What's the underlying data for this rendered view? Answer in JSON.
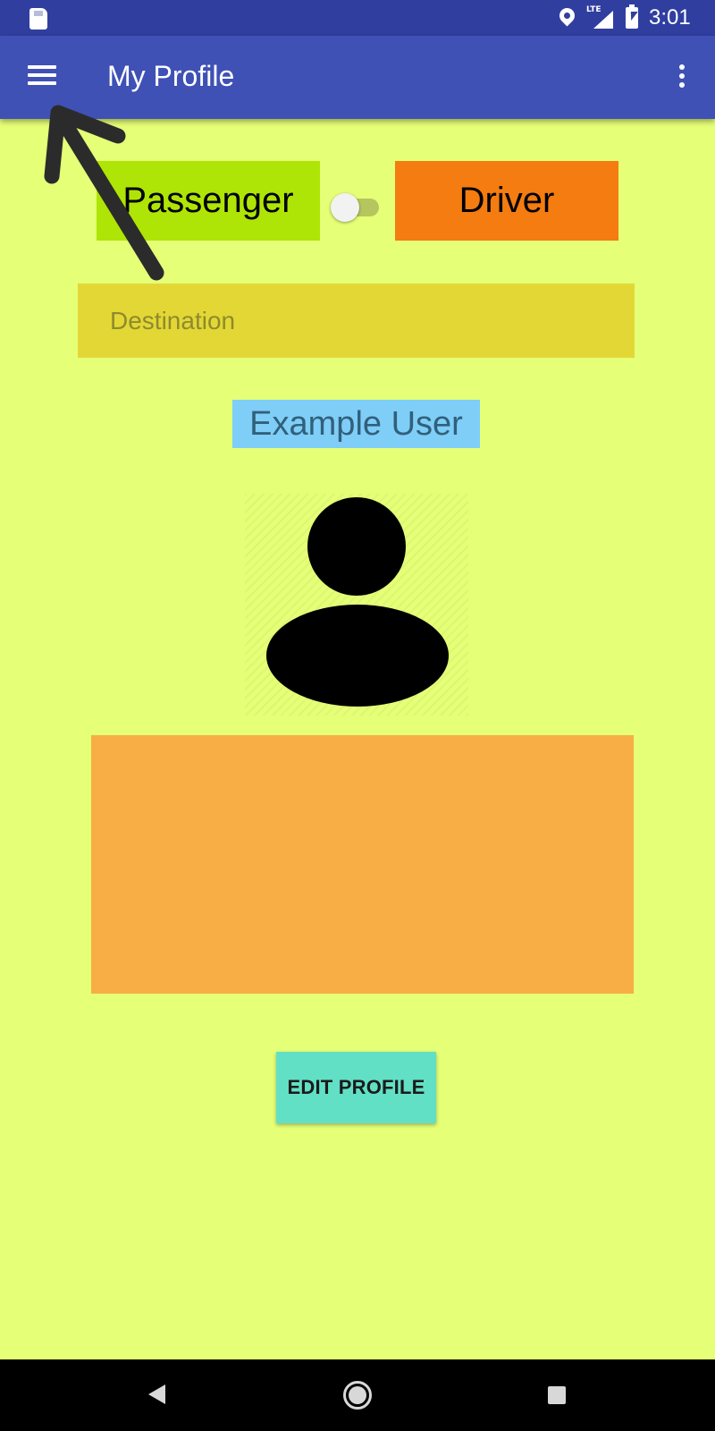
{
  "status_bar": {
    "time": "3:01",
    "network_label": "LTE",
    "icons": [
      "sd-card-icon",
      "location-icon",
      "signal-icon",
      "battery-charging-icon"
    ]
  },
  "app_bar": {
    "title": "My Profile",
    "menu_icon": "hamburger-menu-icon",
    "overflow_icon": "more-vert-icon"
  },
  "role_toggle": {
    "passenger_label": "Passenger",
    "driver_label": "Driver",
    "switch_on": false
  },
  "destination": {
    "placeholder": "Destination",
    "value": ""
  },
  "profile": {
    "user_name": "Example User",
    "avatar_icon": "person-icon",
    "bio": ""
  },
  "actions": {
    "edit_profile_label": "EDIT PROFILE"
  },
  "nav_bar": {
    "icons": [
      "back-icon",
      "home-icon",
      "recents-icon"
    ]
  },
  "colors": {
    "status_bar": "#303f9f",
    "app_bar": "#3f51b5",
    "background": "#e5ff77",
    "passenger": "#aee506",
    "driver": "#f47c10",
    "destination": "#e3d736",
    "user_name_bg": "#7ecef8",
    "bio_box": "#f8ae44",
    "edit_button": "#61e0c6"
  }
}
